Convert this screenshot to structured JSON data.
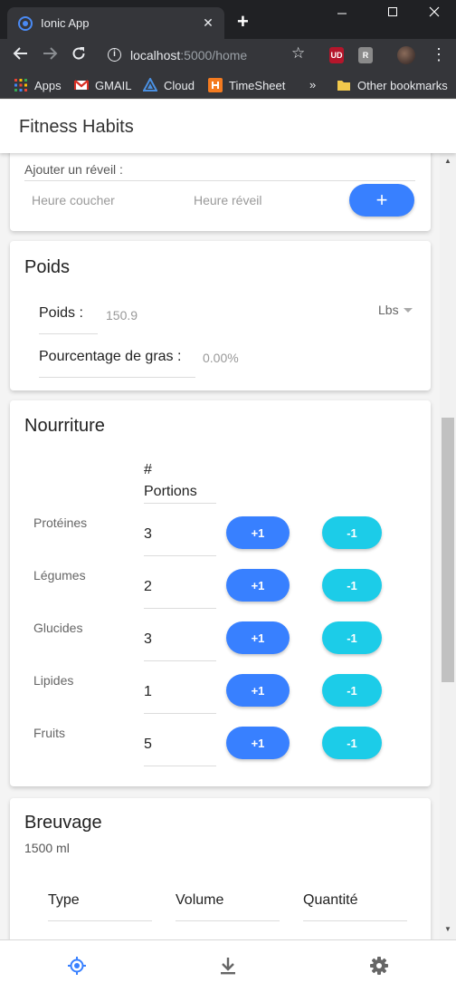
{
  "browser": {
    "tab_title": "Ionic App",
    "tab_close": "✕",
    "new_tab": "+",
    "window_controls": [
      "minimize",
      "maximize",
      "close"
    ],
    "url_host": "localhost",
    "url_rest": ":5000/home",
    "extensions": [
      {
        "name": "ublock",
        "label": "UD",
        "color": "#b5162b"
      },
      {
        "name": "extension",
        "label": "R",
        "color": "#8a8a8a"
      }
    ],
    "bookmarks": [
      {
        "label": "Apps",
        "icon": "apps-grid-icon"
      },
      {
        "label": "GMAIL",
        "icon": "gmail-icon"
      },
      {
        "label": "Cloud",
        "icon": "cloud-icon"
      },
      {
        "label": "TimeSheet",
        "icon": "timesheet-icon"
      }
    ],
    "overflow": "»",
    "other_bookmarks": "Other bookmarks"
  },
  "app": {
    "title": "Fitness Habits",
    "reveil": {
      "label": "Ajouter un réveil :",
      "heure_coucher": "Heure coucher",
      "heure_reveil": "Heure réveil",
      "add_button": "+"
    },
    "poids": {
      "title": "Poids",
      "poids_label": "Poids :",
      "poids_value": "150.9",
      "unit": "Lbs",
      "gras_label": "Pourcentage de gras :",
      "gras_value": "0.00%"
    },
    "nourriture": {
      "title": "Nourriture",
      "header_line1": "#",
      "header_line2": "Portions",
      "plus_label": "+1",
      "minus_label": "-1",
      "items": [
        {
          "name": "Protéines",
          "portions": "3"
        },
        {
          "name": "Légumes",
          "portions": "2"
        },
        {
          "name": "Glucides",
          "portions": "3"
        },
        {
          "name": "Lipides",
          "portions": "1"
        },
        {
          "name": "Fruits",
          "portions": "5"
        }
      ]
    },
    "breuvage": {
      "title": "Breuvage",
      "total": "1500 ml",
      "columns": [
        "Type",
        "Volume",
        "Quantité"
      ]
    },
    "tabs": [
      {
        "name": "tab-locate",
        "icon": "locate-icon",
        "color": "#3880ff"
      },
      {
        "name": "tab-download",
        "icon": "download-icon",
        "color": "#666666"
      },
      {
        "name": "tab-settings",
        "icon": "gear-icon",
        "color": "#666666"
      }
    ]
  }
}
